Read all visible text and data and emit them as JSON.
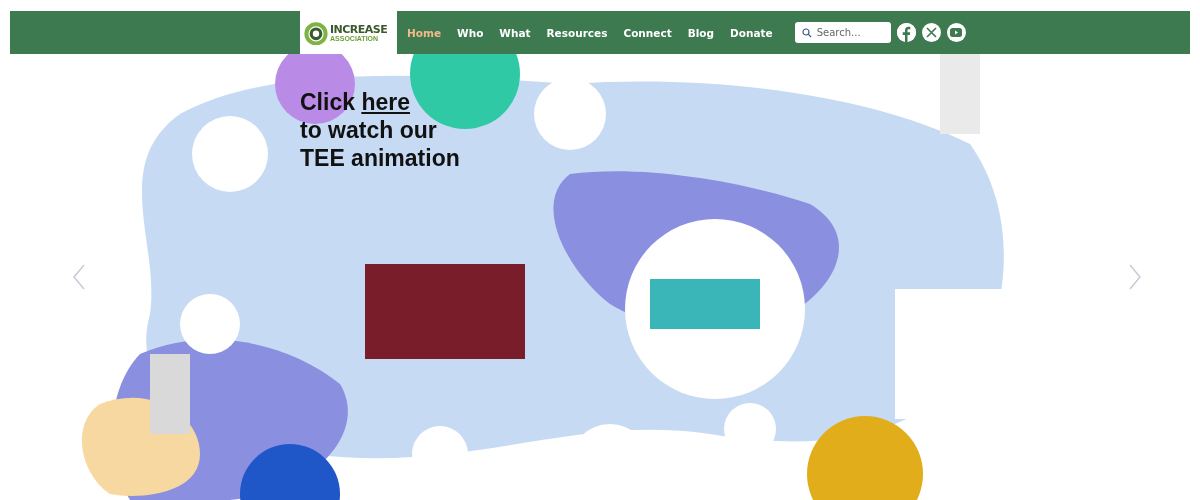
{
  "logo": {
    "word": "INCREASE",
    "subword": "ASSOCIATION"
  },
  "nav": [
    {
      "label": "Home",
      "selected": true
    },
    {
      "label": "Who",
      "selected": false
    },
    {
      "label": "What",
      "selected": false
    },
    {
      "label": "Resources",
      "selected": false
    },
    {
      "label": "Connect",
      "selected": false
    },
    {
      "label": "Blog",
      "selected": false
    },
    {
      "label": "Donate",
      "selected": false
    }
  ],
  "search": {
    "placeholder": "Search..."
  },
  "social": [
    {
      "kind": "facebook"
    },
    {
      "kind": "x"
    },
    {
      "kind": "youtube"
    }
  ],
  "hero": {
    "lead": "Click",
    "link": "here",
    "lines": [
      "to watch our",
      "TEE animation"
    ]
  }
}
